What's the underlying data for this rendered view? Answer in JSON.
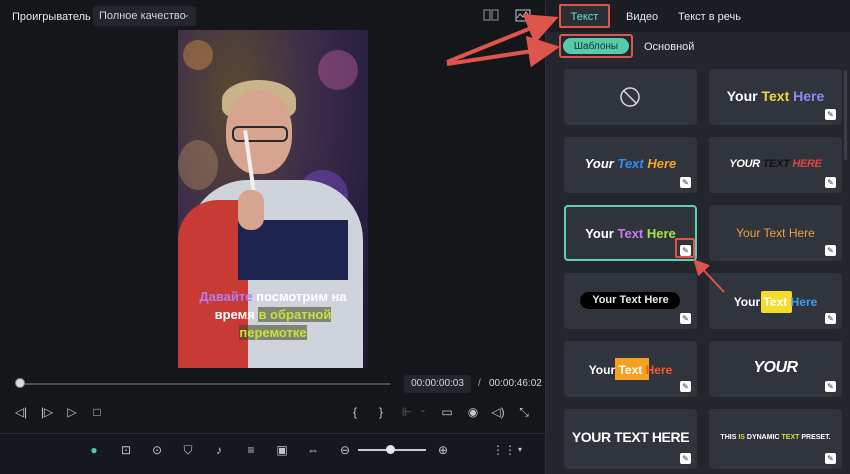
{
  "player": {
    "title": "Проигрыватель",
    "quality": "Полное качество",
    "timecode_current": "00:00:00:03",
    "timecode_separator": "/",
    "timecode_total": "00:00:46:02",
    "playback_progress": 0.0,
    "caption": {
      "line1_a": "Давайте",
      "line1_b": "посмотрим на",
      "line2_a": "время",
      "line2_b": "в обратной",
      "line3": "перемотке"
    },
    "controls": {
      "prev_frame": "◁|",
      "next_frame": "|▷",
      "play": "▷",
      "stop": "□",
      "mark_in": "{",
      "mark_out": "}"
    }
  },
  "panel": {
    "tabs": [
      "Текст",
      "Видео",
      "Текст в речь"
    ],
    "active_tab": "Текст",
    "subtabs": [
      "Шаблоны",
      "Основной"
    ],
    "active_subtab": "Шаблоны",
    "templates": [
      {
        "id": "none"
      },
      {
        "words": [
          "Your",
          "Text",
          "Here"
        ]
      },
      {
        "words": [
          "Your",
          "Text",
          "Here"
        ]
      },
      {
        "words": [
          "YOUR",
          "TEXT",
          "HERE"
        ]
      },
      {
        "words": [
          "Your",
          "Text",
          "Here"
        ],
        "selected": true
      },
      {
        "text": "Your Text Here"
      },
      {
        "text": "Your Text Here"
      },
      {
        "words": [
          "Your",
          "Text",
          "Here"
        ]
      },
      {
        "words": [
          "Your",
          "Text",
          "Here"
        ]
      },
      {
        "text": "YOUR"
      },
      {
        "text": "YOUR TEXT HERE"
      },
      {
        "words": [
          "THIS",
          "IS",
          "DYNAMIC",
          "TEXT",
          "PRESET."
        ]
      }
    ]
  },
  "colors": {
    "accent": "#57c9ad",
    "highlight": "#e0554b"
  }
}
